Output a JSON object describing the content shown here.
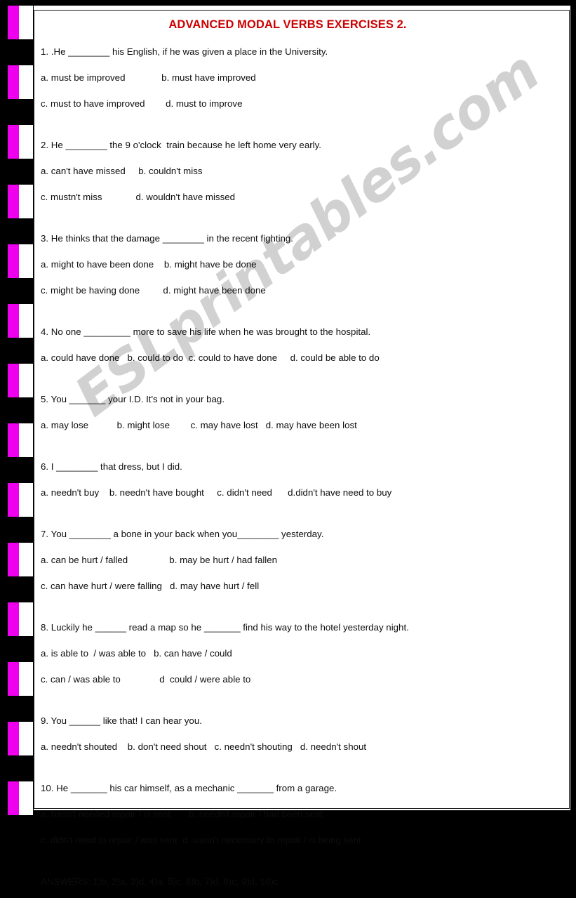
{
  "title": "ADVANCED MODAL VERBS EXERCISES 2.",
  "title_color": "#cc0000",
  "watermark": "ESLprintables.com",
  "binding": {
    "tab_color": "#ee00ee",
    "tab_paper_color": "#ffffff",
    "count": 14
  },
  "questions": [
    {
      "number": "1.",
      "stem": "1. .He ________ his English, if he was given a place in the University.",
      "option_lines": [
        "a. must be improved              b. must have improved",
        "c. must to have improved        d. must to improve"
      ]
    },
    {
      "number": "2.",
      "stem": "2. He ________ the 9 o'clock  train because he left home very early.",
      "option_lines": [
        "a. can't have missed     b. couldn't miss",
        "c. mustn't miss             d. wouldn't have missed"
      ]
    },
    {
      "number": "3.",
      "stem": "3. He thinks that the damage ________ in the recent fighting.",
      "option_lines": [
        "a. might to have been done    b. might have be done",
        "c. might be having done         d. might have been done"
      ]
    },
    {
      "number": "4.",
      "stem": "4. No one _________ more to save his life when he was brought to the hospital.",
      "option_lines": [
        "a. could have done   b. could to do  c. could to have done     d. could be able to do"
      ]
    },
    {
      "number": "5.",
      "stem": "5. You _______ your I.D. It's not in your bag.",
      "option_lines": [
        "a. may lose           b. might lose        c. may have lost   d. may have been lost"
      ]
    },
    {
      "number": "6.",
      "stem": "6. I ________ that dress, but I did.",
      "option_lines": [
        "a. needn't buy    b. needn't have bought     c. didn't need      d.didn't have need to buy"
      ]
    },
    {
      "number": "7.",
      "stem": "7. You ________ a bone in your back when you________ yesterday.",
      "option_lines": [
        "a. can be hurt / falled                b. may be hurt / had fallen",
        "c. can have hurt / were falling   d. may have hurt / fell"
      ]
    },
    {
      "number": "8.",
      "stem": "8. Luckily he ______ read a map so he _______ find his way to the hotel yesterday night.",
      "option_lines": [
        "a. is able to  / was able to   b. can have / could",
        "c. can / was able to               d  could / were able to"
      ]
    },
    {
      "number": "9.",
      "stem": "9. You ______ like that! I can hear you.",
      "option_lines": [
        "a. needn't shouted    b. don't need shout   c. needn't shouting   d. needn't shout"
      ]
    },
    {
      "number": "10.",
      "stem": "10. He _______ his car himself, as a mechanic _______ from a garage.",
      "option_lines": [
        "a. hasn't needed repair / is sent       b. needn't repair / had been sent",
        "c. didn't need to repair / was sent  d. wasn't necessary to repair / is being sent"
      ]
    }
  ],
  "answers": "ANSWERS: 1)b, 2)a, 3)d, 4)a, 5)c, 6)b, 7)d, 8)c, 9)d, 10)c"
}
